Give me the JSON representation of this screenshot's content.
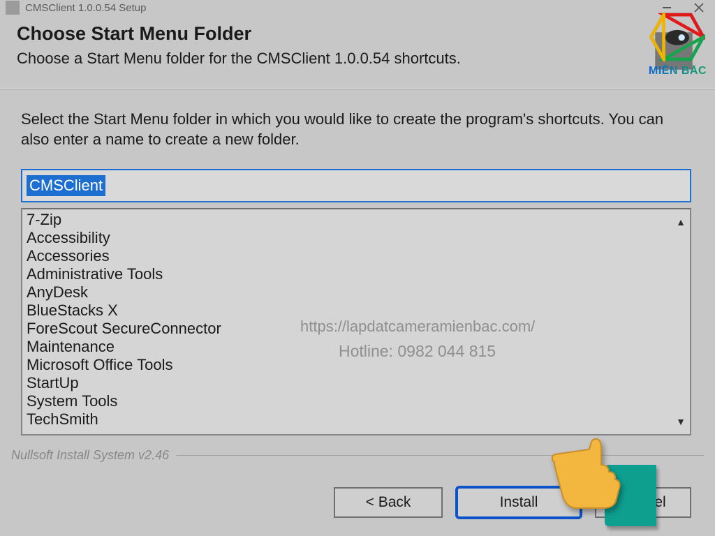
{
  "titlebar": {
    "title": "CMSClient 1.0.0.54 Setup"
  },
  "header": {
    "heading": "Choose Start Menu Folder",
    "subhead": "Choose a Start Menu folder for the CMSClient 1.0.0.54 shortcuts."
  },
  "instructions": "Select the Start Menu folder in which you would like to create the program's shortcuts. You can also enter a name to create a new folder.",
  "folder_input": {
    "value": "CMSClient"
  },
  "folder_list": [
    "7-Zip",
    "Accessibility",
    "Accessories",
    "Administrative Tools",
    "AnyDesk",
    "BlueStacks X",
    "ForeScout SecureConnector",
    "Maintenance",
    "Microsoft Office Tools",
    "StartUp",
    "System Tools",
    "TechSmith"
  ],
  "footer": {
    "brand": "Nullsoft Install System v2.46"
  },
  "buttons": {
    "back": "< Back",
    "install": "Install",
    "cancel": "Cancel"
  },
  "watermark": {
    "url": "https://lapdatcameramienbac.com/",
    "hotline": "Hotline: 0982 044 815"
  },
  "logo": {
    "text": "MIỀN BẮC"
  }
}
